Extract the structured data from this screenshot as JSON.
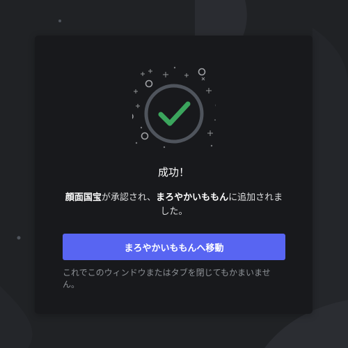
{
  "modal": {
    "title": "成功！",
    "message": {
      "server_name": "顔面国宝",
      "part1": "が承認され、",
      "target_name": "まろやかいももん",
      "part2": "に追加されました。"
    },
    "button_label": "まろやかいももんへ移動",
    "note": "これでこのウィンドウまたはタブを閉じてもかまいません。"
  },
  "colors": {
    "background": "#202225",
    "card": "#18191c",
    "accent": "#5865f2",
    "success": "#3ba55d"
  },
  "icons": {
    "success_icon": "checkmark-circle-icon",
    "decoration": "sparkles-and-circles"
  }
}
